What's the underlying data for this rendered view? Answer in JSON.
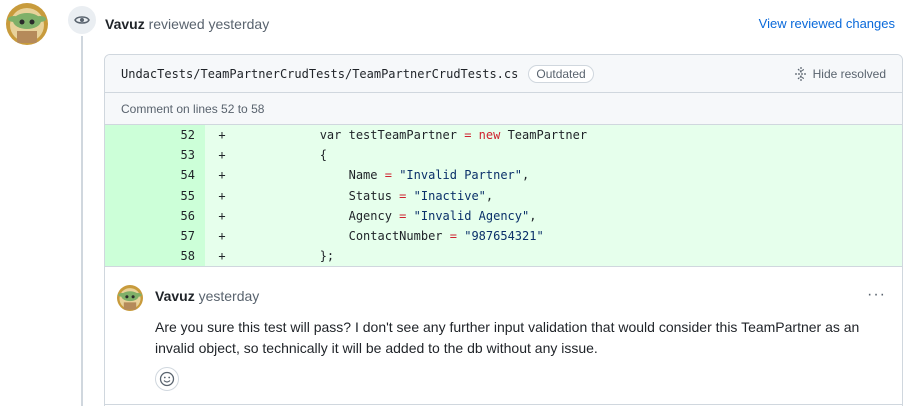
{
  "review": {
    "user": "Vavuz",
    "action_time": "reviewed yesterday",
    "view_changes_label": "View reviewed changes"
  },
  "thread": {
    "file_path": "UndacTests/TeamPartnerCrudTests/TeamPartnerCrudTests.cs",
    "status_badge": "Outdated",
    "hide_resolved_label": "Hide resolved",
    "comment_lines_label": "Comment on lines 52 to 58",
    "diff": [
      {
        "line": "52",
        "sign": "+",
        "code": "            var testTeamPartner = new TeamPartner"
      },
      {
        "line": "53",
        "sign": "+",
        "code": "            {"
      },
      {
        "line": "54",
        "sign": "+",
        "code": "                Name = \"Invalid Partner\","
      },
      {
        "line": "55",
        "sign": "+",
        "code": "                Status = \"Inactive\","
      },
      {
        "line": "56",
        "sign": "+",
        "code": "                Agency = \"Invalid Agency\","
      },
      {
        "line": "57",
        "sign": "+",
        "code": "                ContactNumber = \"987654321\""
      },
      {
        "line": "58",
        "sign": "+",
        "code": "            };"
      }
    ]
  },
  "comment": {
    "user": "Vavuz",
    "time": "yesterday",
    "body": "Are you sure this test will pass? I don't see any further input validation that would consider this TeamPartner as an invalid object, so technically it will be added to the db without any issue.",
    "menu_label": "···"
  },
  "colors": {
    "link": "#0969da",
    "diff_add_bg": "#e6ffec",
    "diff_add_gutter": "#ccffd8",
    "border": "#d0d7de"
  },
  "icons": [
    "avatar",
    "eye-icon",
    "unfold-icon",
    "kebab-icon",
    "smiley-icon"
  ]
}
